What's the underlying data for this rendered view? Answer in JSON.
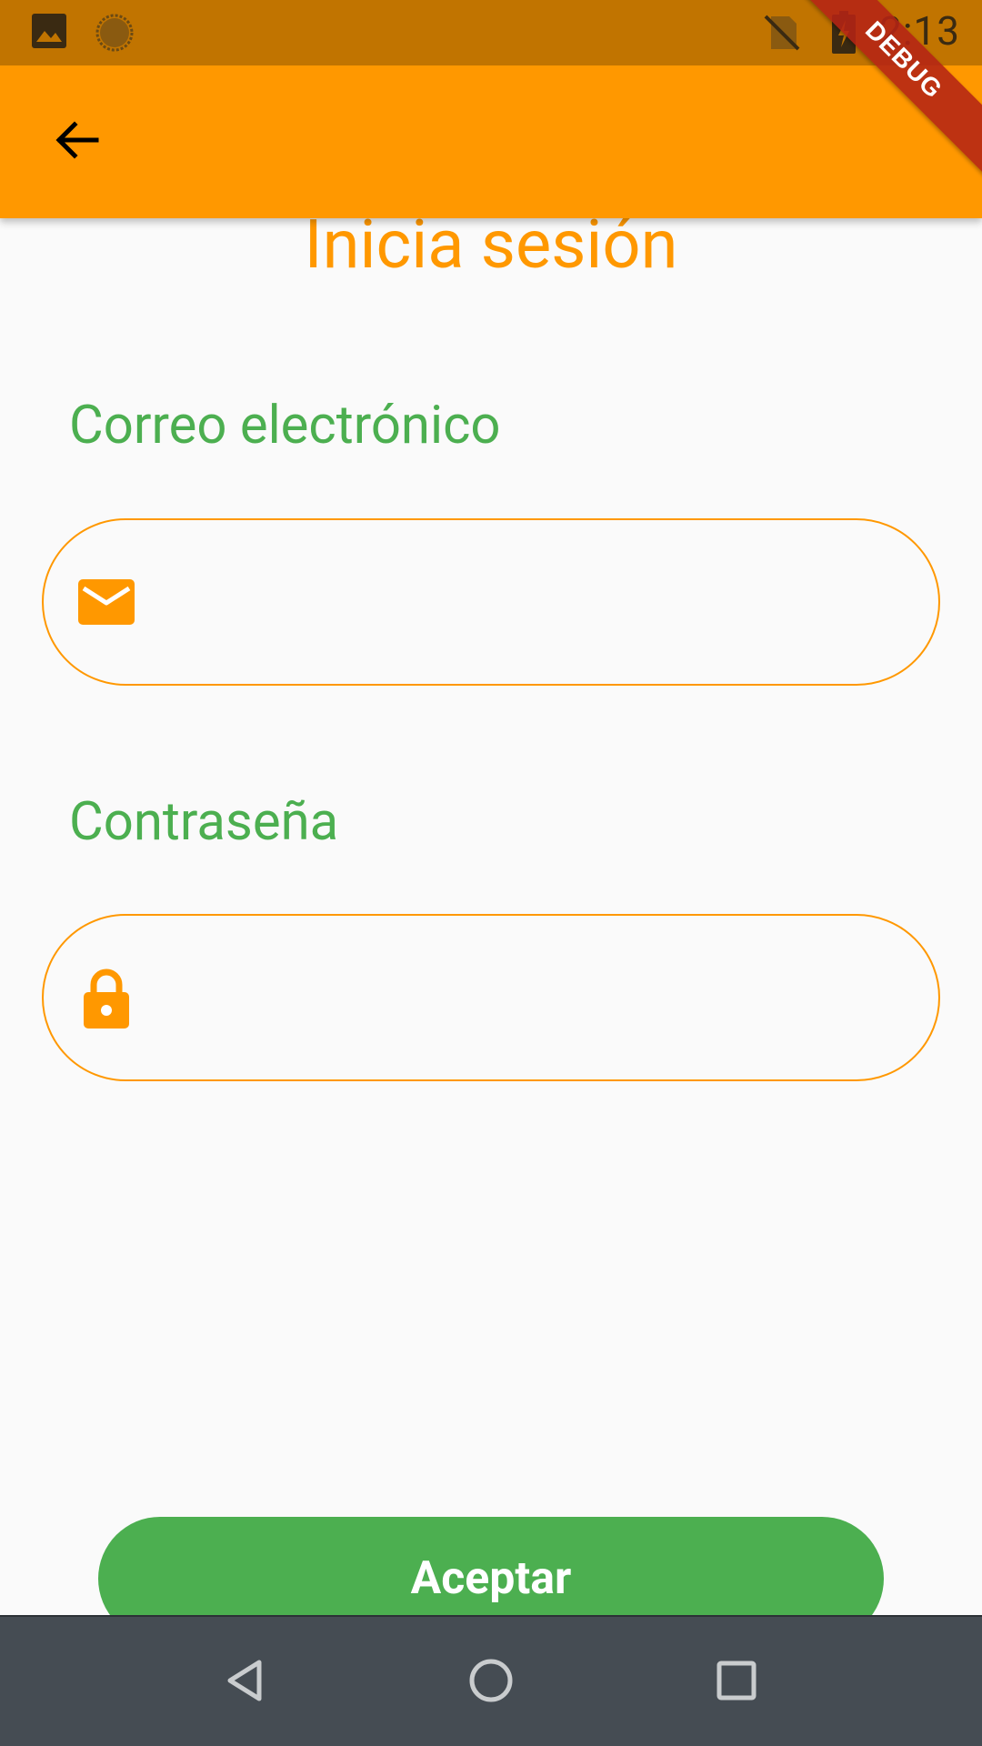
{
  "status_bar": {
    "time": "2:13",
    "icons": [
      "image-icon",
      "progress-icon",
      "no-sim-icon",
      "battery-charging-icon"
    ]
  },
  "app_bar": {
    "back_icon": "arrow-back-icon"
  },
  "debug_banner": "DEBUG",
  "page": {
    "title": "Inicia sesión",
    "email_label": "Correo electrónico",
    "email_value": "",
    "email_icon": "mail-icon",
    "password_label": "Contraseña",
    "password_value": "",
    "password_icon": "lock-icon",
    "accept_button": "Aceptar"
  },
  "nav_bar": {
    "icons": [
      "back-triangle-icon",
      "home-circle-icon",
      "recents-square-icon"
    ]
  },
  "colors": {
    "status_bar": "#c17400",
    "app_bar": "#ff9800",
    "accent_orange": "#ff9800",
    "label_green": "#4caf50",
    "button_green": "#4caf50",
    "nav_bar": "#454c53",
    "background": "#fafafa"
  }
}
